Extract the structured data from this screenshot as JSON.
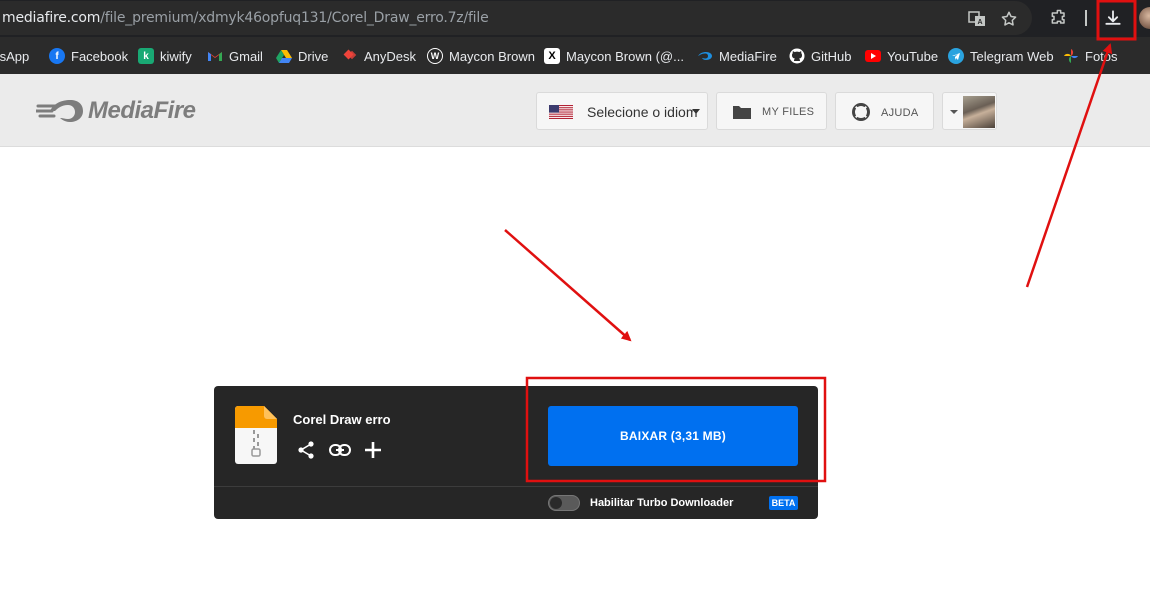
{
  "browser": {
    "url_host": "mediafire.com",
    "url_path": "/file_premium/xdmyk46opfuq131/Corel_Draw_erro.7z/file",
    "icons": [
      "translate-icon",
      "star-icon",
      "extensions-icon",
      "download-icon"
    ]
  },
  "bookmarks": [
    {
      "label": "tsApp",
      "icon": "whatsapp-icon",
      "color": "#25d366"
    },
    {
      "label": "Facebook",
      "icon": "facebook-icon",
      "color": "#1877f2"
    },
    {
      "label": "kiwify",
      "icon": "kiwify-icon",
      "color": "#19a974"
    },
    {
      "label": "Gmail",
      "icon": "gmail-icon",
      "color": "#ea4335"
    },
    {
      "label": "Drive",
      "icon": "drive-icon",
      "color": "#1fa463"
    },
    {
      "label": "AnyDesk",
      "icon": "anydesk-icon",
      "color": "#ef443b"
    },
    {
      "label": "Maycon Brown",
      "icon": "w-icon",
      "color": "#ffffff"
    },
    {
      "label": "Maycon Brown (@...",
      "icon": "x-icon",
      "color": "#000000"
    },
    {
      "label": "MediaFire",
      "icon": "mediafire-icon",
      "color": "#1d8fe0"
    },
    {
      "label": "GitHub",
      "icon": "github-icon",
      "color": "#ffffff"
    },
    {
      "label": "YouTube",
      "icon": "youtube-icon",
      "color": "#ff0000"
    },
    {
      "label": "Telegram Web",
      "icon": "telegram-icon",
      "color": "#2aa3df"
    },
    {
      "label": "Fotos",
      "icon": "photos-icon",
      "color": "#fbbc04"
    }
  ],
  "header": {
    "logo_text": "MediaFire",
    "language_label": "Selecione o idiom",
    "my_files_label": "MY FILES",
    "help_label": "AJUDA"
  },
  "file": {
    "name": "Corel Draw erro",
    "download_label": "BAIXAR (3,31 MB)",
    "turbo_label": "Habilitar Turbo Downloader",
    "turbo_enabled": false,
    "beta_label": "BETA"
  },
  "colors": {
    "accent": "#0070f0",
    "annotation": "#e01010",
    "card_bg": "#262626"
  }
}
